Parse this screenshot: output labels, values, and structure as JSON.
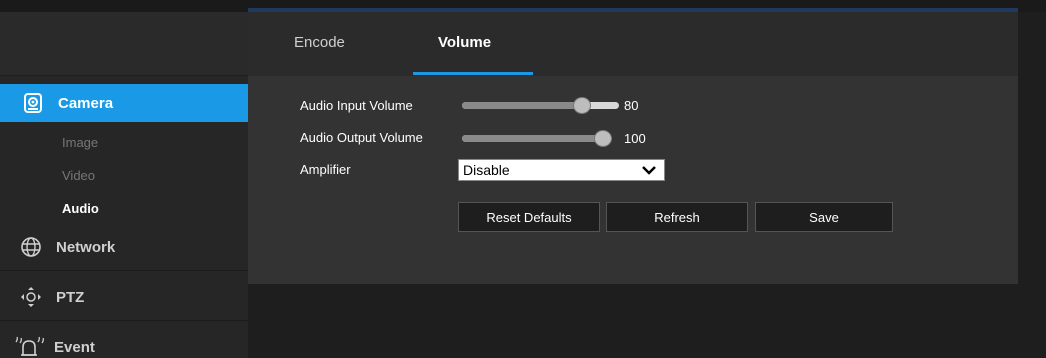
{
  "tabs": [
    {
      "label": "Encode"
    },
    {
      "label": "Volume"
    }
  ],
  "sidebar": {
    "camera": "Camera",
    "sub_items": [
      "Image",
      "Video",
      "Audio"
    ],
    "network": "Network",
    "ptz": "PTZ",
    "event": "Event"
  },
  "form": {
    "audio_input": {
      "label": "Audio Input Volume",
      "value": "80",
      "level": 0.8
    },
    "audio_output": {
      "label": "Audio Output Volume",
      "value": "100",
      "level": 1.0
    },
    "amplifier": {
      "label": "Amplifier",
      "selected": "Disable"
    }
  },
  "buttons": {
    "reset": "Reset Defaults",
    "refresh": "Refresh",
    "save": "Save"
  },
  "colors": {
    "accent": "#1a9ae6",
    "panel": "#333333",
    "sidebar": "#262626"
  }
}
